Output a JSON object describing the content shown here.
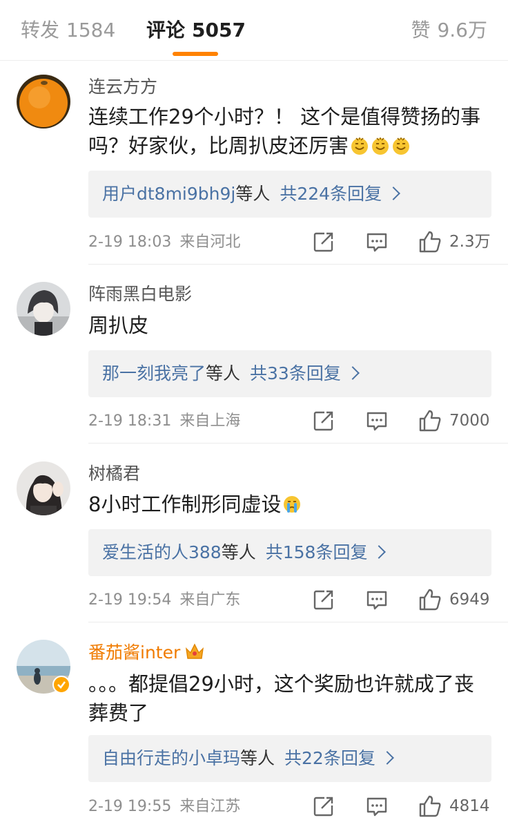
{
  "tabs": {
    "repost_label": "转发",
    "repost_count": "1584",
    "comment_label": "评论",
    "comment_count": "5057",
    "like_label": "赞",
    "like_count": "9.6万"
  },
  "colors": {
    "accent": "#ff8200",
    "link": "#4a72a4",
    "vip_name": "#f07b00"
  },
  "comments": [
    {
      "username": "连云方方",
      "text": "连续工作29个小时？！ 这个是值得赞扬的事吗？好家伙，比周扒皮还厉害",
      "emoji": [
        "sweat-smile-emoji",
        "sweat-smile-emoji",
        "sweat-smile-emoji"
      ],
      "reply_users": "用户dt8mi9bh9j",
      "reply_suffix": "等人",
      "reply_count": "共224条回复",
      "date": "2-19 18:03",
      "source": "来自河北",
      "likes": "2.3万"
    },
    {
      "username": "阵雨黑白电影",
      "text": "周扒皮",
      "reply_users": "那一刻我亮了",
      "reply_suffix": "等人",
      "reply_count": "共33条回复",
      "date": "2-19 18:31",
      "source": "来自上海",
      "likes": "7000"
    },
    {
      "username": "树橘君",
      "text": "8小时工作制形同虚设",
      "emoji": [
        "crying-emoji"
      ],
      "reply_users": "爱生活的人388",
      "reply_suffix": "等人",
      "reply_count": "共158条回复",
      "date": "2-19 19:54",
      "source": "来自广东",
      "likes": "6949"
    },
    {
      "username": "番茄酱inter",
      "text": "。。。都提倡29小时，这个奖励也许就成了丧葬费了",
      "reply_users": "自由行走的小卓玛",
      "reply_suffix": "等人",
      "reply_count": "共22条回复",
      "date": "2-19 19:55",
      "source": "来自江苏",
      "likes": "4814"
    }
  ]
}
